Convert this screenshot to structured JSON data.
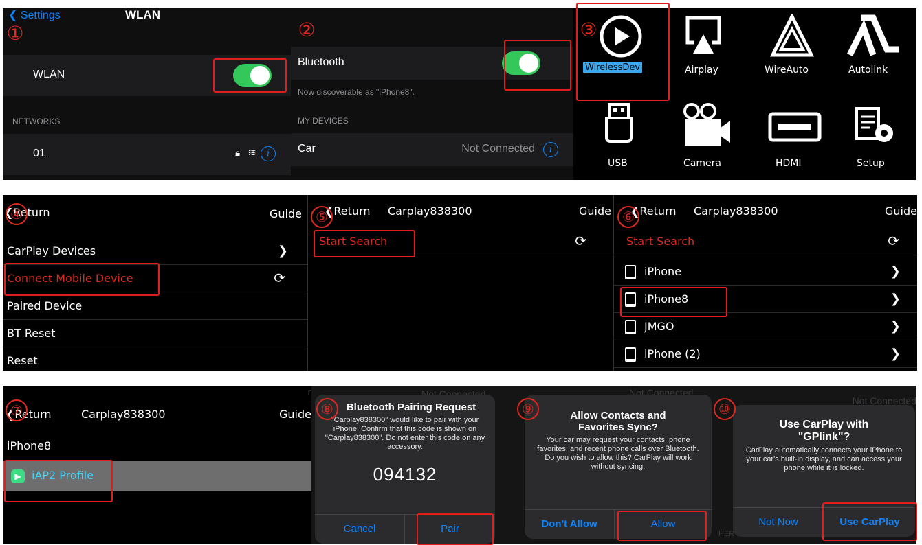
{
  "steps": [
    "①",
    "②",
    "③",
    "④",
    "⑤",
    "⑥",
    "⑦",
    "⑧",
    "⑨",
    "⑩"
  ],
  "p1": {
    "back": "Settings",
    "title": "WLAN",
    "wlan_label": "WLAN",
    "networks_header": "NETWORKS",
    "network_name": "01",
    "info": "i"
  },
  "p2": {
    "bt_label": "Bluetooth",
    "discoverable": "Now discoverable as \"iPhone8\".",
    "my_devices": "MY DEVICES",
    "car": "Car",
    "car_status": "Not Connected",
    "info": "i"
  },
  "p3": {
    "apps": [
      "WirelessDev",
      "Airplay",
      "WireAuto",
      "Autolink",
      "USB",
      "Camera",
      "HDMI",
      "Setup"
    ]
  },
  "p4": {
    "back": "Return",
    "guide": "Guide",
    "items": [
      "CarPlay Devices",
      "Connect Mobile Device",
      "Paired Device",
      "BT Reset",
      "Reset"
    ]
  },
  "p5": {
    "back": "Return",
    "title": "Carplay838300",
    "guide": "Guide",
    "search": "Start Search"
  },
  "p6": {
    "back": "Return",
    "title": "Carplay838300",
    "guide": "Guide",
    "search": "Start Search",
    "devices": [
      "iPhone",
      "iPhone8",
      "JMGO",
      "iPhone (2)"
    ]
  },
  "p7": {
    "back": "Return",
    "title": "Carplay838300",
    "guide": "Guide",
    "device": "iPhone8",
    "profile": "iAP2 Profile"
  },
  "a8": {
    "title": "Bluetooth Pairing Request",
    "message": "\"Carplay838300\" would like to pair with your iPhone. Confirm that this code is shown on \"Carplay838300\". Do not enter this code on any accessory.",
    "code": "094132",
    "cancel": "Cancel",
    "pair": "Pair"
  },
  "a9": {
    "title": "Allow Contacts and Favorites Sync?",
    "message": "Your car may request your contacts, phone favorites, and recent phone calls over Bluetooth. Do you wish to allow this? CarPlay will work without syncing.",
    "deny": "Don't Allow",
    "allow": "Allow"
  },
  "a10": {
    "title": "Use CarPlay with \"GPlink\"?",
    "message": "CarPlay automatically connects your iPhone to your car's built-in display, and can access your phone while it is locked.",
    "not_now": "Not Now",
    "use": "Use CarPlay"
  },
  "bg": {
    "not_connected": "Not Connected",
    "other_devices": "HER DEVICES"
  },
  "colors": {
    "accent_red": "#e11d1d",
    "ios_blue": "#0a84ff",
    "ios_green": "#34c759",
    "search_red": "#e0281e"
  }
}
